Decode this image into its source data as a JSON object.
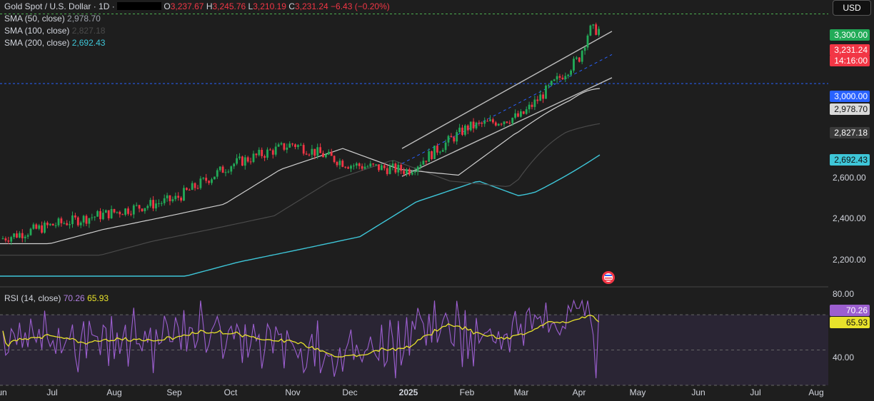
{
  "header": {
    "symbol": "Gold Spot / U.S. Dollar · 1D ·",
    "open_k": "O",
    "open_v": "3,237.67",
    "high_k": "H",
    "high_v": "3,245.76",
    "low_k": "L",
    "low_v": "3,210.19",
    "close_k": "C",
    "close_v": "3,231.24",
    "change": "−6.43 (−0.20%)"
  },
  "sma": [
    {
      "label": "SMA (50, close)",
      "value": "2,978.70",
      "color": "#e0e0e0"
    },
    {
      "label": "SMA (100, close)",
      "value": "2,827.18",
      "color": "#555555"
    },
    {
      "label": "SMA (200, close)",
      "value": "2,692.43",
      "color": "#3ec6d8"
    }
  ],
  "currency": "USD",
  "price_tags": {
    "level_3300": "3,300.00",
    "last_price": "3,231.24",
    "countdown": "14:16:00",
    "level_3000": "3,000.00",
    "sma50": "2,978.70",
    "sma100": "2,827.18",
    "sma200": "2,692.43"
  },
  "rsi": {
    "label": "RSI (14, close)",
    "value": "70.26",
    "ma": "65.93",
    "line_color": "#9c5fd0",
    "ma_color": "#e8e22b"
  },
  "colors": {
    "up": "#26a69a",
    "up_alt": "#22ab58",
    "down": "#f23645",
    "level": "#2962ff",
    "target": "#4caf50"
  },
  "chart_data": [
    {
      "type": "candlestick",
      "title": "Gold Spot / U.S. Dollar · 1D",
      "yticks": [
        "2,200.00",
        "2,400.00",
        "2,600.00",
        "3,300.00"
      ],
      "xticks": [
        "Jun",
        "Jul",
        "Aug",
        "Sep",
        "Oct",
        "Nov",
        "Dec",
        "2025",
        "Feb",
        "Mar",
        "Apr",
        "May",
        "Jun",
        "Jul",
        "Aug"
      ],
      "ylim": [
        2130,
        3360
      ],
      "close_by_month": [
        {
          "x": "Jun",
          "y": 2330
        },
        {
          "x": "Jul",
          "y": 2390
        },
        {
          "x": "Aug",
          "y": 2445
        },
        {
          "x": "Sep",
          "y": 2500
        },
        {
          "x": "Oct",
          "y": 2650
        },
        {
          "x": "Nov",
          "y": 2740
        },
        {
          "x": "Dec",
          "y": 2650
        },
        {
          "x": "2025",
          "y": 2625
        },
        {
          "x": "Feb",
          "y": 2810
        },
        {
          "x": "Mar",
          "y": 2860
        },
        {
          "x": "Apr",
          "y": 3110
        },
        {
          "x": "Apr (last)",
          "y": 3231.24
        }
      ],
      "levels": [
        3300,
        3000
      ],
      "series": [
        {
          "name": "SMA (50, close)",
          "last": 2978.7
        },
        {
          "name": "SMA (100, close)",
          "last": 2827.18
        },
        {
          "name": "SMA (200, close)",
          "last": 2692.43
        }
      ]
    },
    {
      "type": "line",
      "title": "RSI (14, close)",
      "ylim": [
        30,
        85
      ],
      "yticks": [
        "80.00",
        "40.00"
      ],
      "bands": [
        70,
        50,
        30
      ],
      "series": [
        {
          "name": "RSI (14, close)",
          "last": 70.26
        },
        {
          "name": "RSI-based MA",
          "last": 65.93
        }
      ]
    }
  ]
}
